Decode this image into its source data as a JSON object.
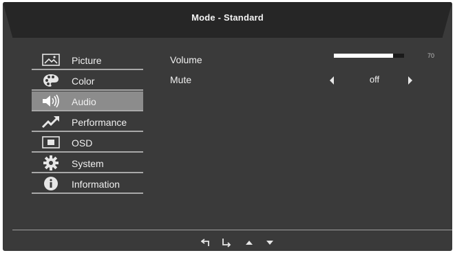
{
  "header": {
    "title": "Mode - Standard"
  },
  "menu": {
    "items": [
      {
        "label": "Picture",
        "icon": "picture-icon"
      },
      {
        "label": "Color",
        "icon": "palette-icon"
      },
      {
        "label": "Audio",
        "icon": "speaker-icon",
        "active": true
      },
      {
        "label": "Performance",
        "icon": "trend-arrow-icon"
      },
      {
        "label": "OSD",
        "icon": "osd-icon"
      },
      {
        "label": "System",
        "icon": "gear-icon"
      },
      {
        "label": "Information",
        "icon": "info-icon"
      }
    ]
  },
  "settings": {
    "volume": {
      "label": "Volume",
      "value": "70",
      "level_percent": 70
    },
    "mute": {
      "label": "Mute",
      "value": "off"
    }
  },
  "footer": {
    "nav_icons": [
      "back-icon",
      "enter-icon",
      "up-icon",
      "down-icon"
    ]
  },
  "colors": {
    "panel": "#3a3a3a",
    "header": "#262626",
    "active_item": "#8c8c8c",
    "divider": "#a9a9a9"
  }
}
